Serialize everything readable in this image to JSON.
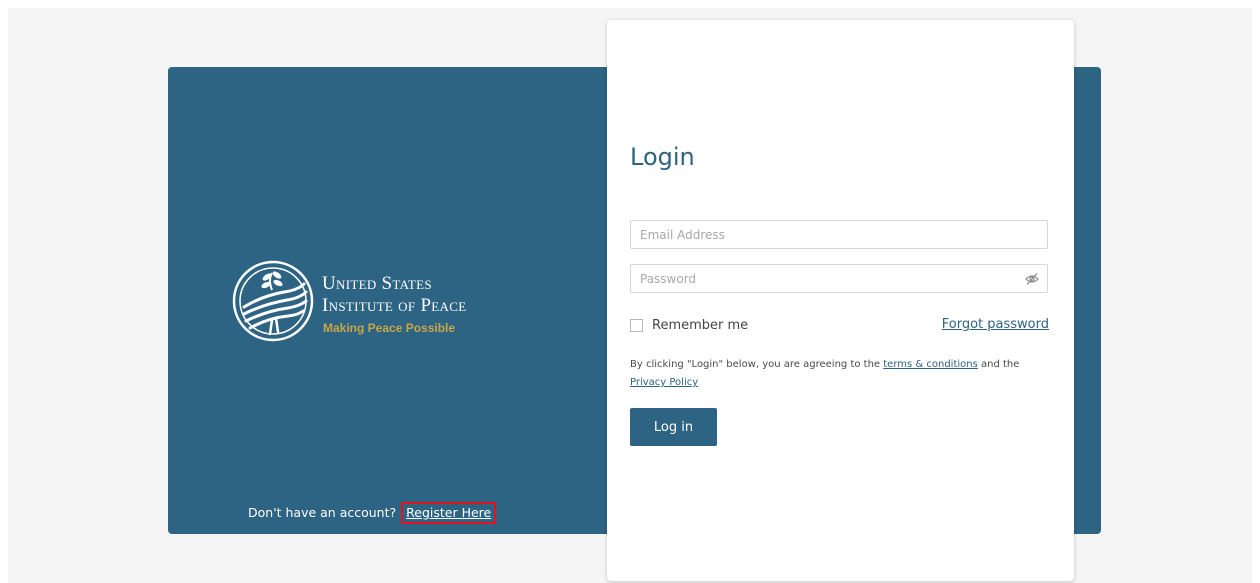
{
  "brand": {
    "line1": "United States",
    "line2": "Institute of Peace",
    "tagline": "Making Peace Possible",
    "panel_color": "#2d6383",
    "tagline_color": "#c8a646"
  },
  "register": {
    "prompt": "Don't have an account?",
    "link_label": "Register Here",
    "highlight_color": "#e0141a"
  },
  "login": {
    "title": "Login",
    "email_placeholder": "Email Address",
    "email_value": "",
    "password_placeholder": "Password",
    "password_value": "",
    "remember_label": "Remember me",
    "remember_checked": false,
    "forgot_label": "Forgot password",
    "terms_prefix": "By clicking \"Login\" below, you are agreeing to the",
    "terms_link": "terms & conditions",
    "terms_and": "and the",
    "privacy_link": "Privacy Policy",
    "button_label": "Log in"
  },
  "icons": {
    "logo": "usip-dove-emblem-icon",
    "password_toggle": "eye-slash-icon"
  }
}
